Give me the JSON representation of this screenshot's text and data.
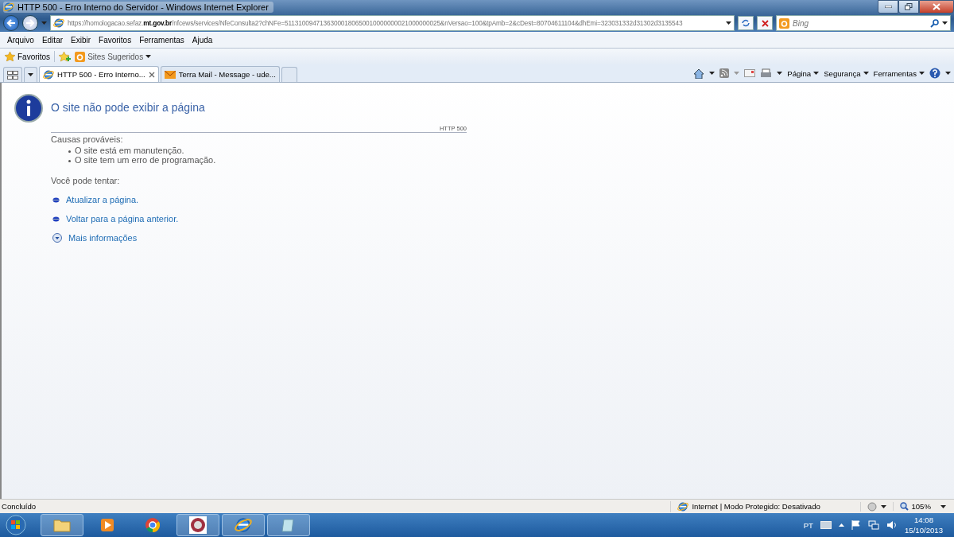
{
  "window": {
    "title": "HTTP 500 - Erro Interno do Servidor - Windows Internet Explorer"
  },
  "address_bar": {
    "url": "https://homologacao.sefaz.**mt.gov.br**/nfcews/services/NfeConsulta2?chNFe=51131009471363000180650010000000021000000025&nVersao=100&tpAmb=2&cDest=80704611104&dhEmi=323031332d31302d3135543"
  },
  "search": {
    "placeholder": "Bing"
  },
  "menu": [
    "Arquivo",
    "Editar",
    "Exibir",
    "Favoritos",
    "Ferramentas",
    "Ajuda"
  ],
  "favorites_bar": {
    "favorites": "Favoritos",
    "suggested": "Sites Sugeridos"
  },
  "tabs": [
    {
      "label": "HTTP 500 - Erro Interno...",
      "selected": true,
      "kind": "ie"
    },
    {
      "label": "Terra Mail - Message - ude...",
      "selected": false,
      "kind": "mail"
    }
  ],
  "command_bar": [
    "Página",
    "Segurança",
    "Ferramentas"
  ],
  "page": {
    "title": "O site não pode exibir a página",
    "code": "HTTP 500",
    "causes_heading": "Causas prováveis:",
    "causes": [
      "O site está em manutenção.",
      "O site tem um erro de programação."
    ],
    "try_heading": "Você pode tentar:",
    "actions": [
      {
        "label": "Atualizar a página.",
        "kind": "bullet"
      },
      {
        "label": "Voltar para a página anterior.",
        "kind": "bullet"
      },
      {
        "label": "Mais informações",
        "kind": "expand"
      }
    ]
  },
  "status_bar": {
    "text": "Concluído",
    "zone": "Internet | Modo Protegido: Desativado",
    "zoom": "105%"
  },
  "taskbar": {
    "apps": [
      {
        "kind": "folder",
        "running": true
      },
      {
        "kind": "media",
        "running": false
      },
      {
        "kind": "chrome",
        "running": false
      },
      {
        "kind": "shield",
        "running": true
      },
      {
        "kind": "ie",
        "running": true
      },
      {
        "kind": "notepad",
        "running": true
      }
    ],
    "language": "PT",
    "time": "14:08",
    "date": "15/10/2013"
  }
}
